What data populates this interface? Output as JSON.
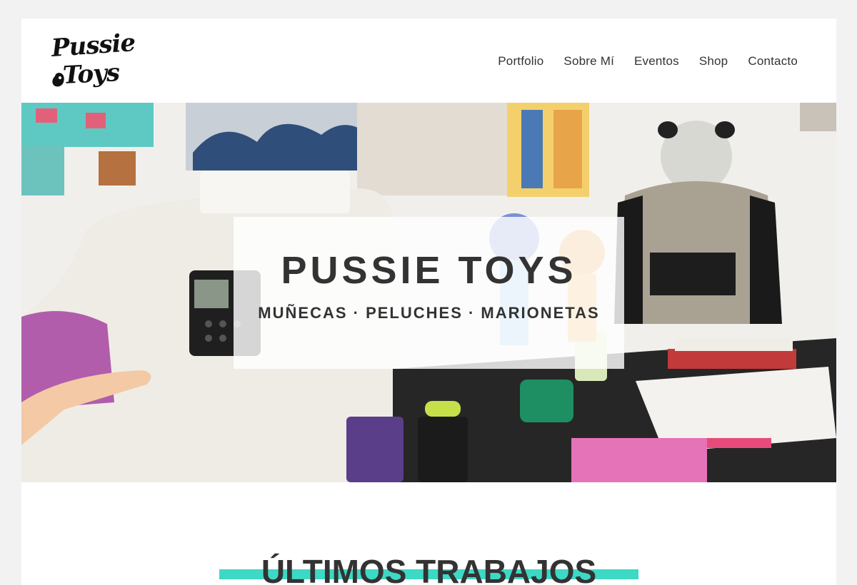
{
  "brand": {
    "logo_line1": "Pussie",
    "logo_line2": "Toys"
  },
  "nav": {
    "items": [
      {
        "label": "Portfolio"
      },
      {
        "label": "Sobre Mí"
      },
      {
        "label": "Eventos"
      },
      {
        "label": "Shop"
      },
      {
        "label": "Contacto"
      }
    ]
  },
  "hero": {
    "title": "PUSSIE TOYS",
    "subtitle": "MUÑECAS · PELUCHES · MARIONETAS"
  },
  "section": {
    "title": "ÚLTIMOS TRABAJOS",
    "accent_color": "#3dd9c5"
  },
  "colors": {
    "page_bg": "#f2f2f2",
    "text": "#333333"
  }
}
